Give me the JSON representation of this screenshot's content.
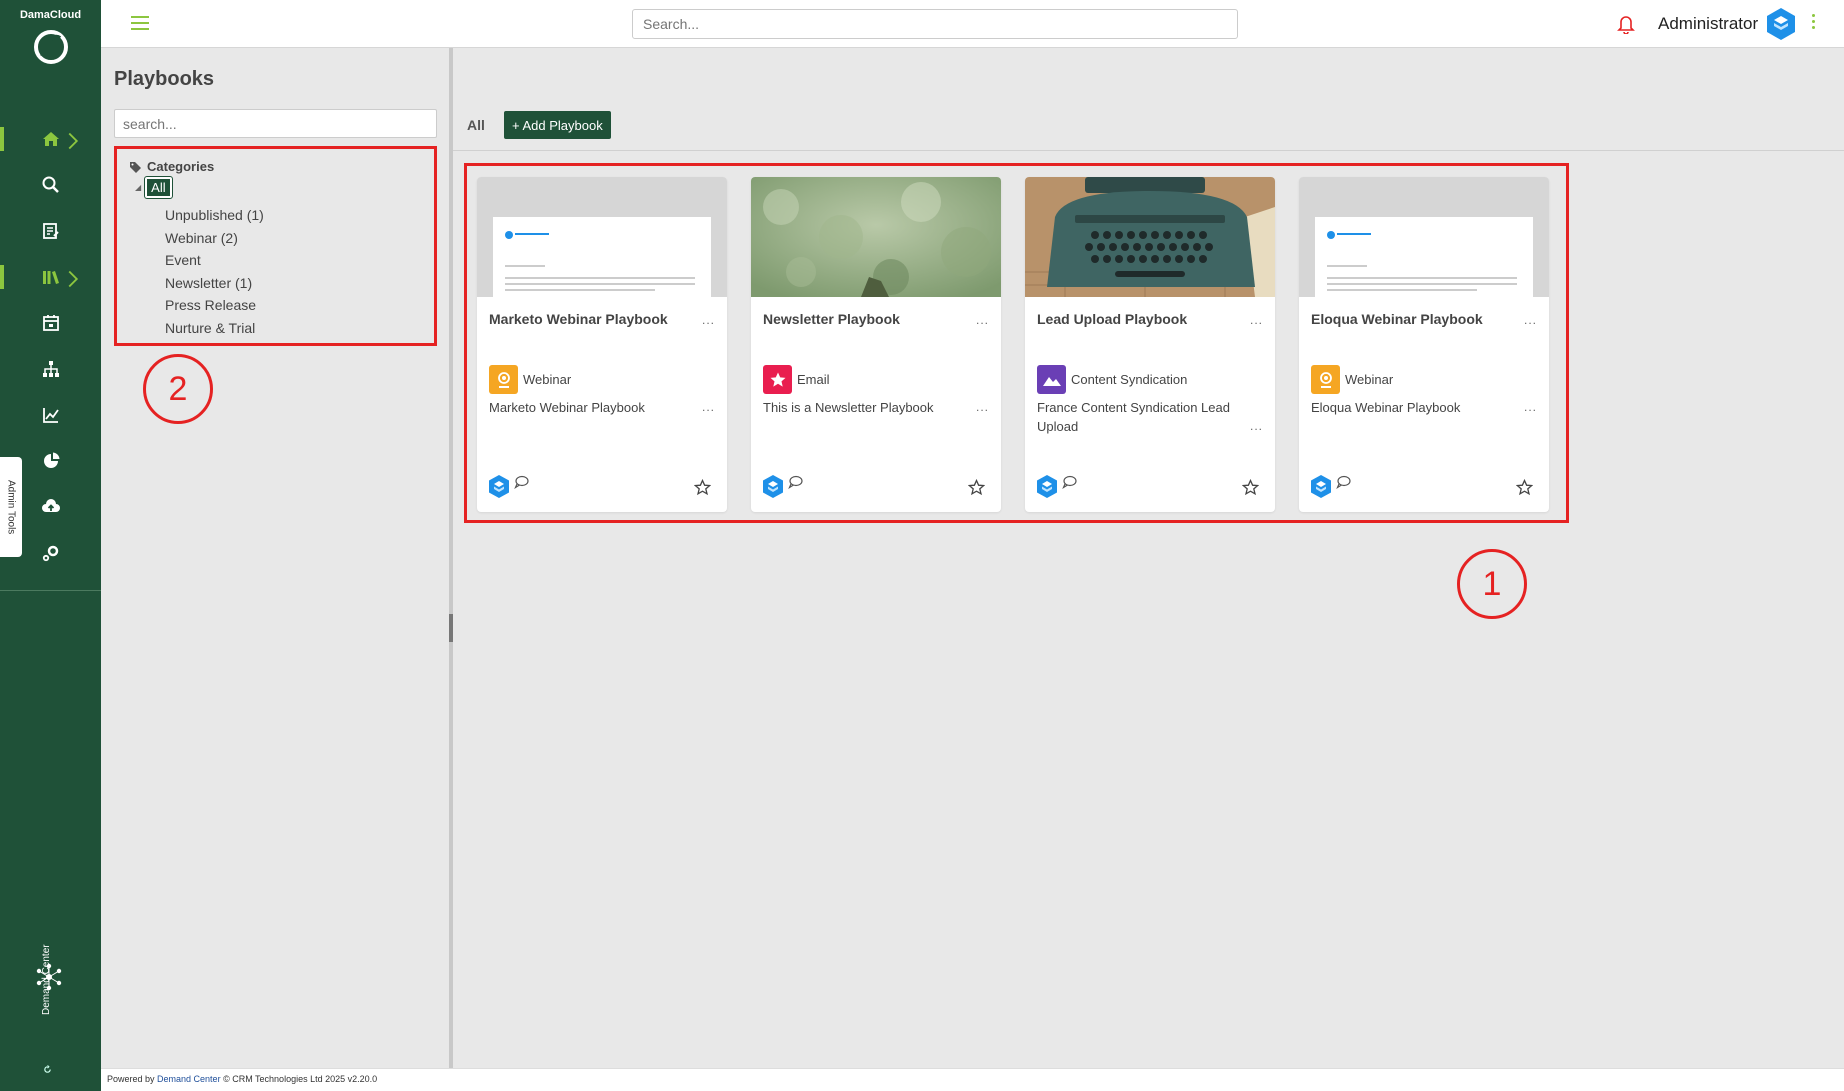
{
  "rail": {
    "brand": "DamaCloud",
    "admin_tab": "Admin Tools",
    "demand_label": "Demand Center"
  },
  "topbar": {
    "search_placeholder": "Search...",
    "user_name": "Administrator"
  },
  "page": {
    "title": "Playbooks"
  },
  "categories": {
    "search_placeholder": "search...",
    "heading": "Categories",
    "all_label": "All",
    "items": [
      "Unpublished (1)",
      "Webinar (2)",
      "Event",
      "Newsletter (1)",
      "Press Release",
      "Nurture & Trial"
    ]
  },
  "markers": {
    "one": "1",
    "two": "2"
  },
  "toolbar": {
    "tab_all": "All",
    "add_label": "+ Add Playbook"
  },
  "cards": [
    {
      "title": "Marketo Webinar Playbook",
      "type": "Webinar",
      "desc": "Marketo Webinar Playbook",
      "menu": "...",
      "desc_menu": "..."
    },
    {
      "title": "Newsletter Playbook",
      "type": "Email",
      "desc": "This is a Newsletter Playbook",
      "menu": "...",
      "desc_menu": "..."
    },
    {
      "title": "Lead Upload Playbook",
      "type": "Content Syndication",
      "desc": "France Content Syndication Lead Upload",
      "menu": "...",
      "desc_menu": "..."
    },
    {
      "title": "Eloqua Webinar Playbook",
      "type": "Webinar",
      "desc": "Eloqua Webinar Playbook",
      "menu": "...",
      "desc_menu": "..."
    }
  ],
  "footer": {
    "prefix": "Powered by ",
    "link": "Demand Center",
    "suffix": " © CRM Technologies Ltd 2025 v2.20.0"
  },
  "colors": {
    "rail": "#1f5138",
    "accent": "#8cc63f",
    "annotation": "#e52222",
    "webinar": "#f5a623",
    "email": "#e91e4f",
    "syndication": "#6a3fb5"
  }
}
